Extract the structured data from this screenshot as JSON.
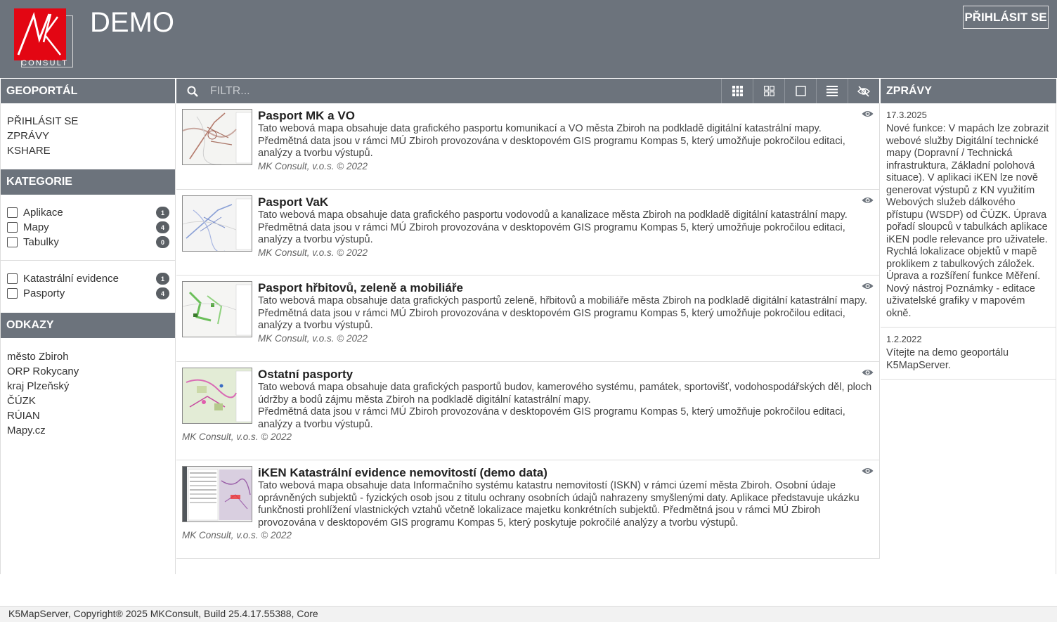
{
  "header": {
    "logo_text": "CONSULT",
    "title": "DEMO",
    "login_label": "PŘIHLÁSIT SE"
  },
  "left": {
    "title": "GEOPORTÁL",
    "links": [
      "PŘIHLÁSIT SE",
      "ZPRÁVY",
      "KSHARE"
    ],
    "categories_title": "KATEGORIE",
    "categories_a": [
      {
        "label": "Aplikace",
        "count": "1"
      },
      {
        "label": "Mapy",
        "count": "4"
      },
      {
        "label": "Tabulky",
        "count": "0"
      }
    ],
    "categories_b": [
      {
        "label": "Katastrální evidence",
        "count": "1"
      },
      {
        "label": "Pasporty",
        "count": "4"
      }
    ],
    "links_title": "ODKAZY",
    "external_links": [
      "město Zbiroh",
      "ORP Rokycany",
      "kraj Plzeňský",
      "ČÚZK",
      "RÚIAN",
      "Mapy.cz"
    ]
  },
  "toolbar": {
    "filter_placeholder": "FILTR..."
  },
  "maps": [
    {
      "title": "Pasport MK a VO",
      "desc": [
        "Tato webová mapa obsahuje data grafického pasportu komunikací a VO města Zbiroh na podkladě digitální katastrální mapy.",
        "Předmětná data jsou v rámci MÚ Zbiroh provozována v desktopovém GIS programu Kompas 5, který umožňuje pokročilou editaci, analýzy a tvorbu výstupů."
      ],
      "meta": "MK Consult, v.o.s. © 2022"
    },
    {
      "title": "Pasport VaK",
      "desc": [
        "Tato webová mapa obsahuje data grafického pasportu vodovodů a kanalizace města Zbiroh na podkladě digitální katastrální mapy.",
        "Předmětná data jsou v rámci MÚ Zbiroh provozována v desktopovém GIS programu Kompas 5, který umožňuje pokročilou editaci, analýzy a tvorbu výstupů."
      ],
      "meta": "MK Consult, v.o.s. © 2022"
    },
    {
      "title": "Pasport hřbitovů, zeleně a mobiliáře",
      "desc": [
        "Tato webová mapa obsahuje data grafických pasportů zeleně, hřbitovů a mobiliáře města Zbiroh na podkladě digitální katastrální mapy.",
        "Předmětná data jsou v rámci MÚ Zbiroh provozována v desktopovém GIS programu Kompas 5, který umožňuje pokročilou editaci, analýzy a tvorbu výstupů."
      ],
      "meta": "MK Consult, v.o.s. © 2022"
    },
    {
      "title": "Ostatní pasporty",
      "desc": [
        "Tato webová mapa obsahuje data grafických pasportů budov, kamerového systému, památek, sportovišť, vodohospodářských děl, ploch údržby a bodů zájmu města Zbiroh na podkladě digitální katastrální mapy.",
        "Předmětná data jsou v rámci MÚ Zbiroh provozována v desktopovém GIS programu Kompas 5, který umožňuje pokročilou editaci, analýzy a tvorbu výstupů."
      ],
      "meta": "MK Consult, v.o.s. © 2022"
    },
    {
      "title": "iKEN Katastrální evidence nemovitostí (demo data)",
      "desc": [
        "Tato webová mapa obsahuje data Informačního systému katastru nemovitostí (ISKN) v rámci území města Zbiroh. Osobní údaje oprávněných subjektů - fyzických osob jsou z titulu ochrany osobních údajů nahrazeny smyšlenými daty. Aplikace představuje ukázku funkčnosti prohlížení vlastnických vztahů včetně lokalizace majetku konkrétních subjektů. Předmětná jsou v rámci MÚ Zbiroh provozována v desktopovém GIS programu Kompas 5, který poskytuje pokročilé analýzy a tvorbu výstupů."
      ],
      "meta": "MK Consult, v.o.s. © 2022"
    }
  ],
  "news": {
    "title": "ZPRÁVY",
    "items": [
      {
        "date": "17.3.2025",
        "text": "Nové funkce: V mapách lze zobrazit webové služby Digitální technické mapy (Dopravní / Technická infrastruktura, Základní polohová situace). V aplikaci iKEN lze nově generovat výstupů z KN využitím Webových služeb dálkového přístupu (WSDP) od ČÚZK. Úprava pořadí sloupců v tabulkách aplikace iKEN podle relevance pro uživatele. Rychlá lokalizace objektů v mapě proklikem z tabulkových záložek. Úprava a rozšíření funkce Měření. Nový nástroj Poznámky - editace uživatelské grafiky v mapovém okně."
      },
      {
        "date": "1.2.2022",
        "text": "Vítejte na demo geoportálu K5MapServer."
      }
    ]
  },
  "footer": {
    "text": "K5MapServer, Copyright® 2025 MKConsult, Build 25.4.17.55388, Core"
  },
  "colors": {
    "header_bg": "#6c737c",
    "logo_red": "#e30613",
    "badge_bg": "#5a5f64"
  }
}
